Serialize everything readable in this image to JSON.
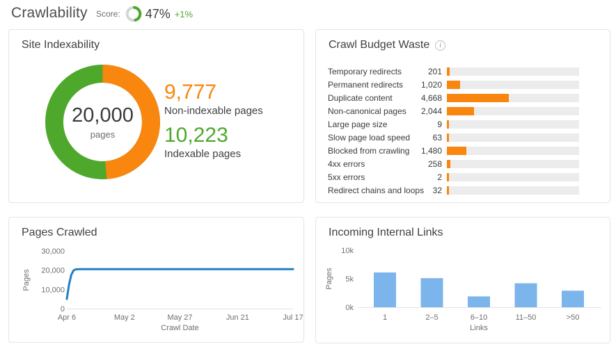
{
  "header": {
    "title": "Crawlability",
    "score_label": "Score:",
    "score_value": "47%",
    "score_percent": 47,
    "score_delta": "+1%"
  },
  "colors": {
    "orange": "#f9860e",
    "green": "#4ea82c",
    "score_track": "#d6d6d6",
    "line_blue": "#1f80c4",
    "bar_blue": "#7cb5ec",
    "bar_track": "#ececec",
    "baseline": "#dde3ec",
    "axis_text": "#6e6e6e"
  },
  "chart_data": [
    {
      "id": "site_indexability",
      "type": "pie",
      "title": "Site Indexability",
      "total": 20000,
      "total_display": "20,000",
      "total_unit": "pages",
      "slices": [
        {
          "label": "Non-indexable pages",
          "value": 9777,
          "display": "9,777",
          "color": "#f9860e"
        },
        {
          "label": "Indexable pages",
          "value": 10223,
          "display": "10,223",
          "color": "#4ea82c"
        }
      ]
    },
    {
      "id": "crawl_budget_waste",
      "type": "bar",
      "orientation": "horizontal",
      "title": "Crawl Budget Waste",
      "info_icon_glyph": "i",
      "xmax": 10000,
      "categories": [
        "Temporary redirects",
        "Permanent redirects",
        "Duplicate content",
        "Non-canonical pages",
        "Large page size",
        "Slow page load speed",
        "Blocked from crawling",
        "4xx errors",
        "5xx errors",
        "Redirect chains and loops"
      ],
      "values": [
        201,
        1020,
        4668,
        2044,
        9,
        63,
        1480,
        258,
        2,
        32
      ],
      "value_displays": [
        "201",
        "1,020",
        "4,668",
        "2,044",
        "9",
        "63",
        "1,480",
        "258",
        "2",
        "32"
      ],
      "bar_color": "#f9860e",
      "track_color": "#ececec"
    },
    {
      "id": "pages_crawled",
      "type": "line",
      "title": "Pages Crawled",
      "xlabel": "Crawl Date",
      "ylabel": "Pages",
      "ylim": [
        0,
        30000
      ],
      "y_ticks": [
        {
          "value": 0,
          "label": "0"
        },
        {
          "value": 10000,
          "label": "10,000"
        },
        {
          "value": 20000,
          "label": "20,000"
        },
        {
          "value": 30000,
          "label": "30,000"
        }
      ],
      "x_ticks": [
        {
          "day": 0,
          "label": "Apr 6"
        },
        {
          "day": 26,
          "label": "May 2"
        },
        {
          "day": 51,
          "label": "May 27"
        },
        {
          "day": 77,
          "label": "Jun 21"
        },
        {
          "day": 102,
          "label": "Jul 17"
        }
      ],
      "points": [
        {
          "day": 0,
          "value": 5000
        },
        {
          "day": 1,
          "value": 12500
        },
        {
          "day": 2,
          "value": 17500
        },
        {
          "day": 3,
          "value": 19800
        },
        {
          "day": 4,
          "value": 20400
        },
        {
          "day": 6,
          "value": 20500
        },
        {
          "day": 102,
          "value": 20500
        }
      ],
      "color": "#1f80c4",
      "grid": false
    },
    {
      "id": "incoming_internal_links",
      "type": "bar",
      "orientation": "vertical",
      "title": "Incoming Internal Links",
      "xlabel": "Links",
      "ylabel": "Pages",
      "ylim": [
        0,
        10000
      ],
      "y_ticks": [
        {
          "value": 0,
          "label": "0k"
        },
        {
          "value": 5000,
          "label": "5k"
        },
        {
          "value": 10000,
          "label": "10k"
        }
      ],
      "categories": [
        "1",
        "2–5",
        "6–10",
        "11–50",
        ">50"
      ],
      "values": [
        6100,
        5100,
        1900,
        4200,
        2900
      ],
      "color": "#7cb5ec",
      "grid": false
    }
  ]
}
